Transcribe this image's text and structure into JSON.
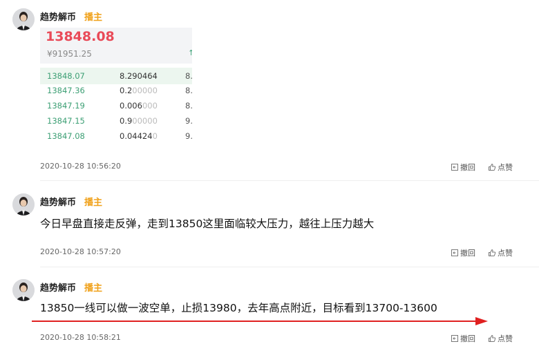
{
  "posts": [
    {
      "author": "趋势解币",
      "role": "播主",
      "time": "2020-10-28 10:56:20",
      "card": {
        "price": "13848.08",
        "cny": "¥91951.25",
        "mark": "↑",
        "rows": [
          {
            "price": "13848.07",
            "qty_dark": "8.290464",
            "qty_light": "",
            "extra": "8."
          },
          {
            "price": "13847.36",
            "qty_dark": "0.2",
            "qty_light": "00000",
            "extra": "8."
          },
          {
            "price": "13847.19",
            "qty_dark": "0.006",
            "qty_light": "000",
            "extra": "8."
          },
          {
            "price": "13847.15",
            "qty_dark": "0.9",
            "qty_light": "00000",
            "extra": "9."
          },
          {
            "price": "13847.08",
            "qty_dark": "0.04424",
            "qty_light": "0",
            "extra": "9."
          }
        ]
      },
      "actions": {
        "revoke": "撤回",
        "like": "点赞"
      }
    },
    {
      "author": "趋势解币",
      "role": "播主",
      "content": "今日早盘直接走反弹，走到13850这里面临较大压力，越往上压力越大",
      "time": "2020-10-28 10:57:20",
      "actions": {
        "revoke": "撤回",
        "like": "点赞"
      }
    },
    {
      "author": "趋势解币",
      "role": "播主",
      "content": "13850一线可以做一波空单，止损13980，去年高点附近，目标看到13700-13600",
      "time": "2020-10-28 10:58:21",
      "actions": {
        "revoke": "撤回",
        "like": "点赞"
      }
    }
  ],
  "colors": {
    "role": "#f0a11a",
    "price_up": "#e94a58",
    "bid": "#3c9f74",
    "arrow": "#e02020"
  },
  "icons": [
    "avatar",
    "revoke-icon",
    "like-icon",
    "red-arrow"
  ]
}
